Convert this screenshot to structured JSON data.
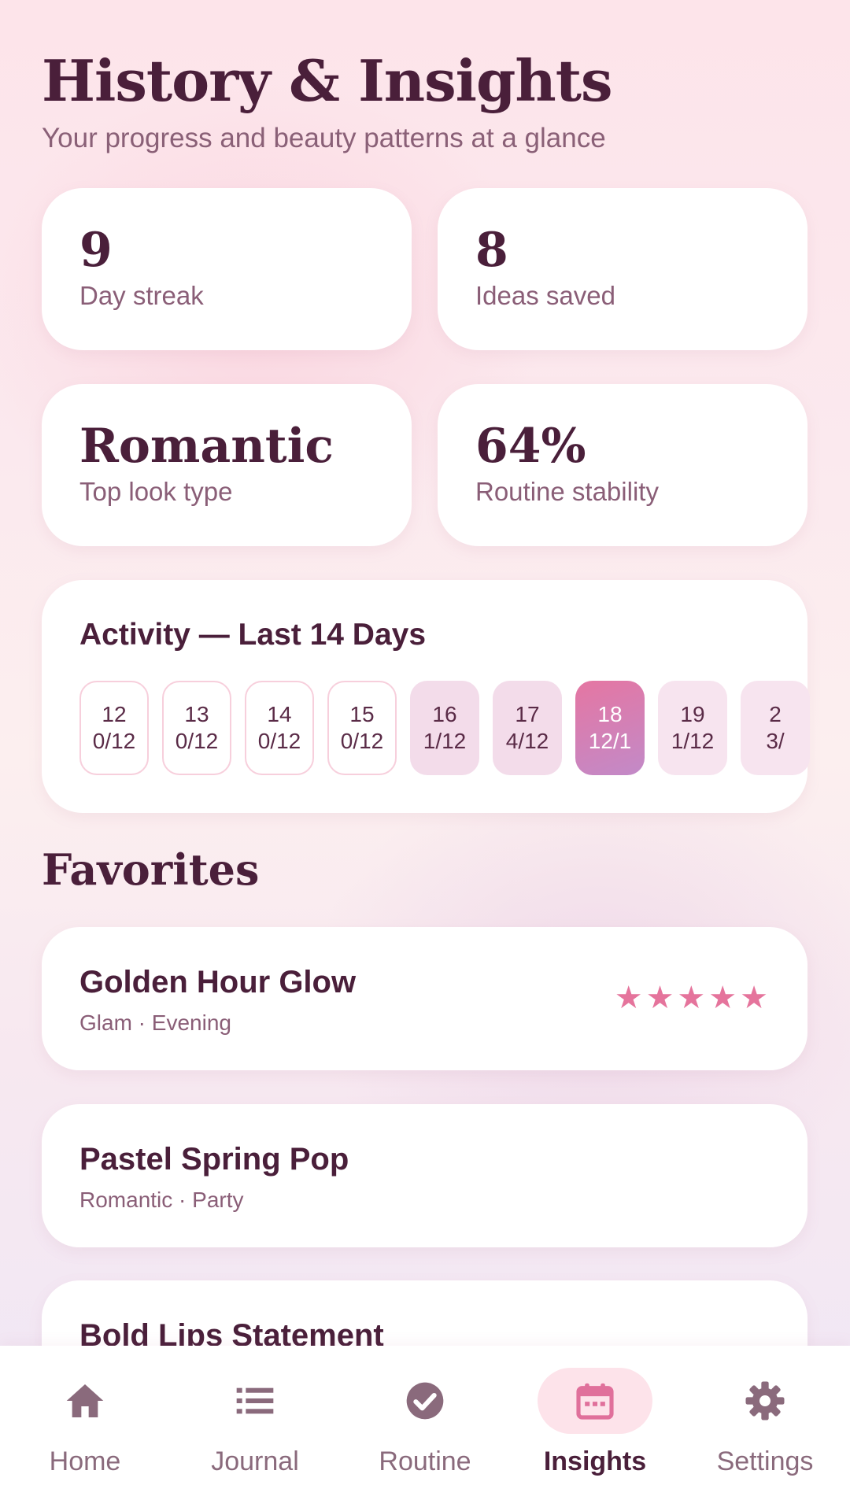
{
  "header": {
    "title": "History & Insights",
    "subtitle": "Your progress and beauty patterns at a glance"
  },
  "stats": [
    {
      "value": "9",
      "label": "Day streak"
    },
    {
      "value": "8",
      "label": "Ideas saved"
    },
    {
      "value": "Romantic",
      "label": "Top look type"
    },
    {
      "value": "64%",
      "label": "Routine stability"
    }
  ],
  "activity": {
    "title": "Activity — Last 14 Days",
    "days": [
      {
        "day": "12",
        "count": "0/12"
      },
      {
        "day": "13",
        "count": "0/12"
      },
      {
        "day": "14",
        "count": "0/12"
      },
      {
        "day": "15",
        "count": "0/12"
      },
      {
        "day": "16",
        "count": "1/12"
      },
      {
        "day": "17",
        "count": "4/12"
      },
      {
        "day": "18",
        "count": "12/1"
      },
      {
        "day": "19",
        "count": "1/12"
      },
      {
        "day": "2",
        "count": "3/"
      }
    ]
  },
  "favorites": {
    "title": "Favorites",
    "items": [
      {
        "title": "Golden Hour Glow",
        "subtitle": "Glam · Evening",
        "rating": 5
      },
      {
        "title": "Pastel Spring Pop",
        "subtitle": "Romantic · Party"
      },
      {
        "title": "Bold Lips Statement",
        "subtitle": ""
      }
    ]
  },
  "nav": {
    "items": [
      {
        "label": "Home",
        "icon": "home-icon"
      },
      {
        "label": "Journal",
        "icon": "list-icon"
      },
      {
        "label": "Routine",
        "icon": "check-circle-icon"
      },
      {
        "label": "Insights",
        "icon": "calendar-icon"
      },
      {
        "label": "Settings",
        "icon": "gear-icon"
      }
    ],
    "active": "Insights"
  },
  "colors": {
    "accent": "#e5749c",
    "text": "#4a1f3a",
    "muted": "#8a5e77",
    "active_pill": "#fde3ea"
  }
}
